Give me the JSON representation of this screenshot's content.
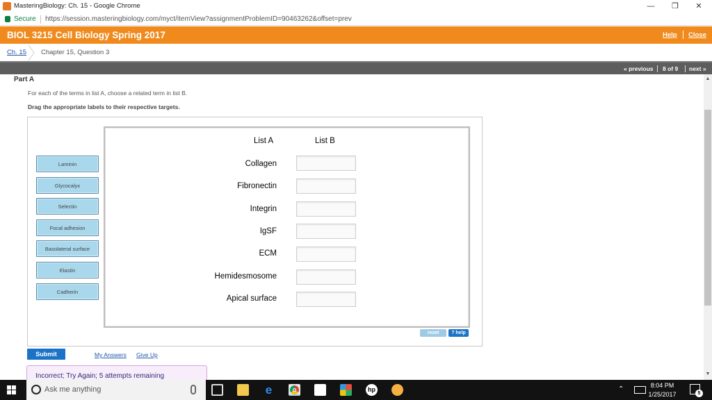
{
  "window": {
    "title": "MasteringBiology: Ch. 15 - Google Chrome"
  },
  "address_bar": {
    "secure_label": "Secure",
    "url": "https://session.masteringbiology.com/myct/itemView?assignmentProblemID=90463262&offset=prev"
  },
  "header": {
    "course_title": "BIOL 3215 Cell Biology Spring 2017",
    "help_label": "Help",
    "close_label": "Close"
  },
  "breadcrumb": {
    "chapter_link": "Ch. 15",
    "current": "Chapter 15, Question 3"
  },
  "pager": {
    "previous_label": "« previous",
    "position": "8 of 9",
    "next_label": "next »"
  },
  "question": {
    "part_title": "Part A",
    "prompt": "For each of the terms in list A, choose a related term in list B.",
    "instruction": "Drag the appropriate labels to their respective targets."
  },
  "dnd": {
    "list_a_header": "List A",
    "list_b_header": "List B",
    "labels": [
      "Laminin",
      "Glycocalyx",
      "Selectin",
      "Focal adhesion",
      "Basolateral surface",
      "Elastin",
      "Cadherin"
    ],
    "terms": [
      "Collagen",
      "Fibronectin",
      "Integrin",
      "IgSF",
      "ECM",
      "Hemidesmosome",
      "Apical surface"
    ],
    "reset_label": "reset",
    "help_label": "? help"
  },
  "actions": {
    "submit_label": "Submit",
    "my_answers_label": "My Answers",
    "give_up_label": "Give Up"
  },
  "feedback": {
    "text": "Incorrect; Try Again; 5 attempts remaining",
    "accent_color": "#d6a3e0"
  },
  "taskbar": {
    "search_placeholder": "Ask me anything",
    "time": "8:04 PM",
    "date": "1/25/2017",
    "notification_count": "5"
  },
  "colors": {
    "brand_orange": "#f08a1d",
    "label_chip": "#a9d7ec",
    "submit_blue": "#1a73c7"
  }
}
